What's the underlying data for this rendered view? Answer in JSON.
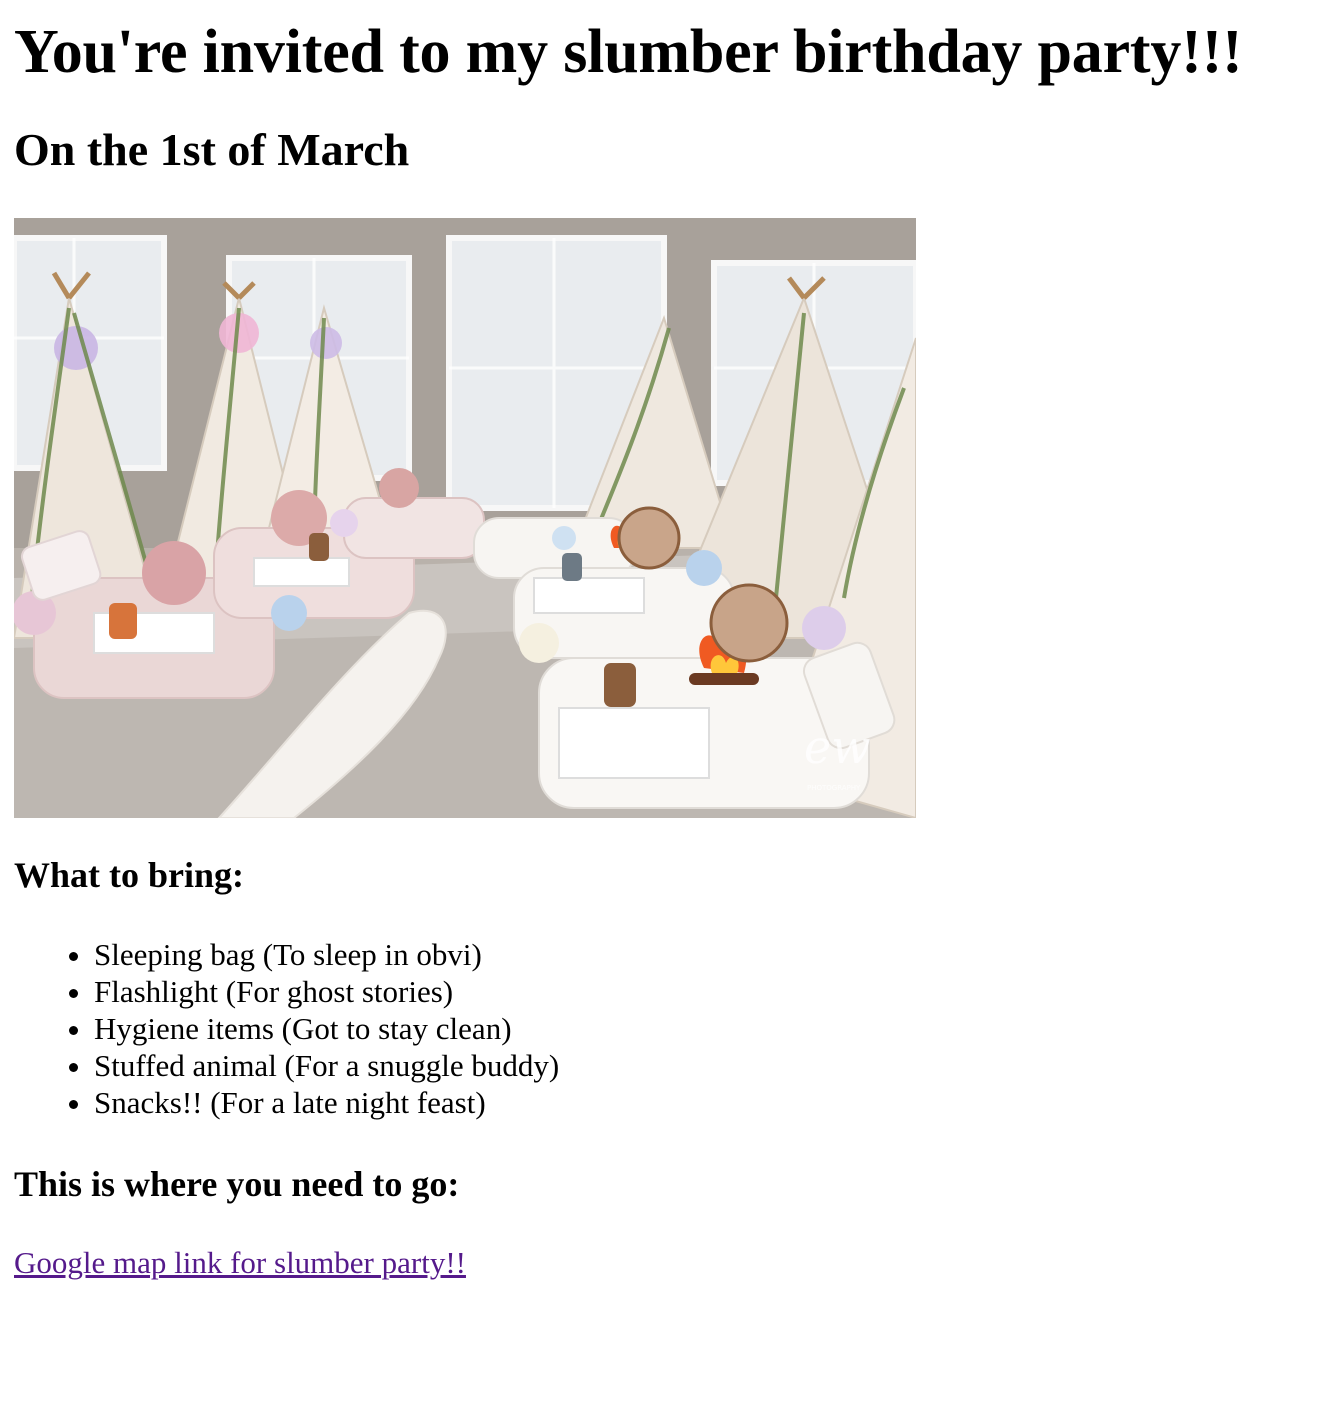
{
  "header": {
    "title": "You're invited to my slumber birthday party!!!",
    "date": "On the 1st of March"
  },
  "photo": {
    "watermark": "ew",
    "watermark_sub": "PHOTOGRAPHY"
  },
  "bring": {
    "heading": "What to bring:",
    "items": [
      "Sleeping bag (To sleep in obvi)",
      "Flashlight (For ghost stories)",
      "Hygiene items (Got to stay clean)",
      "Stuffed animal (For a snuggle buddy)",
      "Snacks!! (For a late night feast)"
    ]
  },
  "location": {
    "heading": "This is where you need to go:",
    "link_label": "Google map link for slumber party!!"
  },
  "colors": {
    "link": "#551a8b",
    "text": "#000000",
    "background": "#ffffff"
  }
}
